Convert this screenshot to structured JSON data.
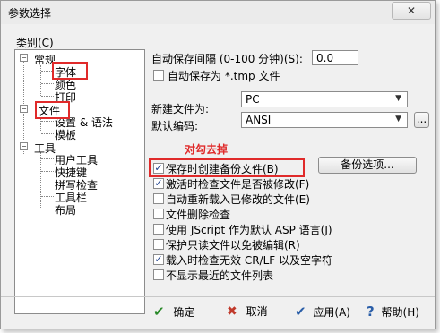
{
  "window": {
    "title": "参数选择",
    "close_glyph": "✕"
  },
  "category": {
    "label": "类别(C)",
    "items": [
      {
        "label": "常规",
        "children": [
          {
            "label": "字体"
          },
          {
            "label": "颜色"
          },
          {
            "label": "打印"
          }
        ]
      },
      {
        "label": "文件",
        "children": [
          {
            "label": "设置 & 语法"
          },
          {
            "label": "模板"
          }
        ]
      },
      {
        "label": "工具",
        "children": [
          {
            "label": "用户工具"
          },
          {
            "label": "快捷键"
          },
          {
            "label": "拼写检查"
          },
          {
            "label": "工具栏"
          },
          {
            "label": "布局"
          }
        ]
      }
    ],
    "expander_minus": "−"
  },
  "autosave": {
    "label": "自动保存间隔 (0-100 分钟)(S):",
    "value": "0.0",
    "tmp_label": "自动保存为 *.tmp 文件",
    "tmp_checked": false
  },
  "new_file": {
    "label": "新建文件为:",
    "value": "PC"
  },
  "encoding": {
    "label": "默认编码:",
    "value": "ANSI",
    "more_label": "..."
  },
  "annotation": "对勾去掉",
  "backup_options_label": "备份选项...",
  "checkboxes": [
    {
      "label": "保存时创建备份文件(B)",
      "checked": true
    },
    {
      "label": "激活时检查文件是否被修改(F)",
      "checked": true
    },
    {
      "label": "自动重新载入已修改的文件(E)",
      "checked": false
    },
    {
      "label": "文件删除检查",
      "checked": false
    },
    {
      "label": "使用 JScript 作为默认 ASP 语言(J)",
      "checked": false
    },
    {
      "label": "保护只读文件以免被编辑(R)",
      "checked": false
    },
    {
      "label": "载入时检查无效 CR/LF 以及空字符",
      "checked": true
    },
    {
      "label": "不显示最近的文件列表",
      "checked": false
    }
  ],
  "buttons": {
    "ok": "确定",
    "cancel": "取消",
    "apply": "应用(A)",
    "help": "帮助(H)"
  },
  "icons": {
    "ok": "✔",
    "cancel": "✖",
    "apply": "✔",
    "help": "?"
  },
  "colors": {
    "highlight": "#e02a2a",
    "check": "#1a3e8c"
  }
}
